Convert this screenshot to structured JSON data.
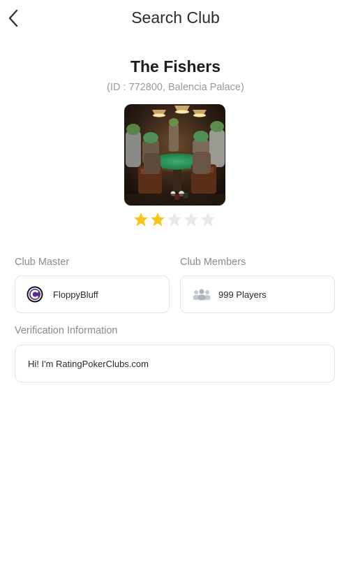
{
  "header": {
    "title": "Search Club",
    "back_icon": "chevron-left-icon"
  },
  "club": {
    "name": "The Fishers",
    "id_line": "(ID : 772800, Balencia Palace)",
    "rating": 2,
    "rating_max": 5,
    "star_color": "#F5C518",
    "star_empty_color": "#E6E8EC"
  },
  "master": {
    "label": "Club Master",
    "name": "FloppyBluff",
    "avatar_icon": "club-master-avatar-icon"
  },
  "members": {
    "label": "Club Members",
    "count_text": "999 Players",
    "icon": "people-group-icon"
  },
  "verification": {
    "label": "Verification Information",
    "text": "Hi! I'm RatingPokerClubs.com"
  }
}
